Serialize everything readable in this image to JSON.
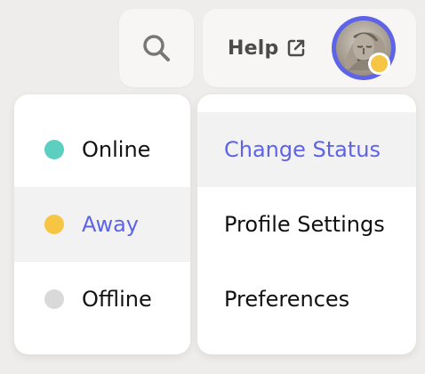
{
  "topbar": {
    "help_label": "Help",
    "search_icon": "search-icon",
    "help_icon": "external-link-icon",
    "avatar_status": "away"
  },
  "status_menu": {
    "items": [
      {
        "label": "Online",
        "color": "#5ccfc0",
        "active": false
      },
      {
        "label": "Away",
        "color": "#f6c544",
        "active": true
      },
      {
        "label": "Offline",
        "color": "#d9d9d9",
        "active": false
      }
    ]
  },
  "user_menu": {
    "items": [
      {
        "label": "Change Status",
        "active": true
      },
      {
        "label": "Profile Settings",
        "active": false
      },
      {
        "label": "Preferences",
        "active": false
      }
    ]
  },
  "theme": {
    "accent": "#5e63e8",
    "background": "#efedeb",
    "panel": "#ffffff",
    "active_bg": "#f3f2f2"
  }
}
